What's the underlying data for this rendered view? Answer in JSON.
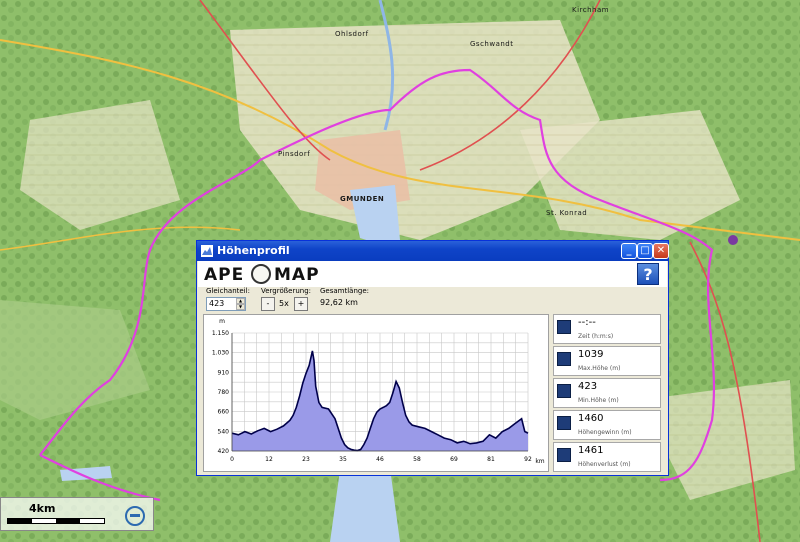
{
  "map": {
    "labels": [
      "GMUNDEN",
      "St. Konrad",
      "Gschwandt",
      "Kirchham",
      "Ohlsdorf",
      "Pinsdorf"
    ],
    "route_color": "#e040e0",
    "marker_color": "#7a3aa0",
    "lake_color": "#b9d2f1"
  },
  "scale": {
    "label": "4km"
  },
  "window": {
    "title": "Höhenprofil",
    "logo_left": "APE",
    "logo_right": "MAP",
    "help_label": "?",
    "minimize_label": "_",
    "maximize_label": "□",
    "close_label": "✕"
  },
  "controls": {
    "smoothing_label": "Gleichanteil:",
    "smoothing_value": "423",
    "zoom_label": "Vergrößerung:",
    "zoom_minus": "-",
    "zoom_value": "5x",
    "zoom_plus": "+",
    "total_label": "Gesamtlänge:",
    "total_value": "92,62 km"
  },
  "stats": [
    {
      "icon": "hourglass-icon",
      "value": "--:--",
      "label": "Zeit (h:m:s)"
    },
    {
      "icon": "max-height-icon",
      "value": "1039",
      "label": "Max.Höhe (m)"
    },
    {
      "icon": "min-height-icon",
      "value": "423",
      "label": "Min.Höhe (m)"
    },
    {
      "icon": "ascent-icon",
      "value": "1460",
      "label": "Höhengewinn (m)"
    },
    {
      "icon": "descent-icon",
      "value": "1461",
      "label": "Höhenverlust (m)"
    }
  ],
  "chart_data": {
    "type": "area",
    "ylabel": "m",
    "xlabel": "km",
    "x_ticks": [
      "0",
      "12",
      "23",
      "35",
      "46",
      "58",
      "69",
      "81",
      "92"
    ],
    "y_ticks": [
      "420",
      "540",
      "660",
      "780",
      "910",
      "1.030",
      "1.150"
    ],
    "xlim": [
      0,
      92
    ],
    "ylim": [
      420,
      1150
    ],
    "grid": true,
    "fill_color": "#9a9ae8",
    "line_color": "#00004a",
    "series": [
      {
        "x": [
          0,
          2,
          4,
          6,
          8,
          10,
          12,
          14,
          16,
          18,
          19,
          20,
          21,
          22,
          23,
          24,
          25,
          25.5,
          26,
          27,
          28,
          30,
          32,
          33,
          34,
          35,
          36,
          37,
          38,
          39,
          40,
          41,
          42,
          43,
          44,
          45,
          46,
          47,
          48,
          49,
          50,
          51,
          52,
          53,
          54,
          55,
          56,
          58,
          60,
          62,
          64,
          66,
          68,
          70,
          72,
          74,
          76,
          78,
          80,
          82,
          84,
          86,
          88,
          90,
          91,
          92
        ],
        "values": [
          530,
          520,
          540,
          525,
          545,
          560,
          540,
          555,
          575,
          610,
          640,
          690,
          760,
          840,
          900,
          950,
          1039,
          980,
          820,
          720,
          690,
          680,
          620,
          560,
          500,
          460,
          440,
          430,
          425,
          423,
          430,
          460,
          500,
          560,
          620,
          660,
          680,
          690,
          700,
          720,
          780,
          850,
          810,
          720,
          640,
          600,
          580,
          570,
          560,
          540,
          520,
          500,
          490,
          470,
          480,
          465,
          470,
          480,
          520,
          500,
          540,
          560,
          590,
          620,
          540,
          530
        ]
      }
    ]
  }
}
